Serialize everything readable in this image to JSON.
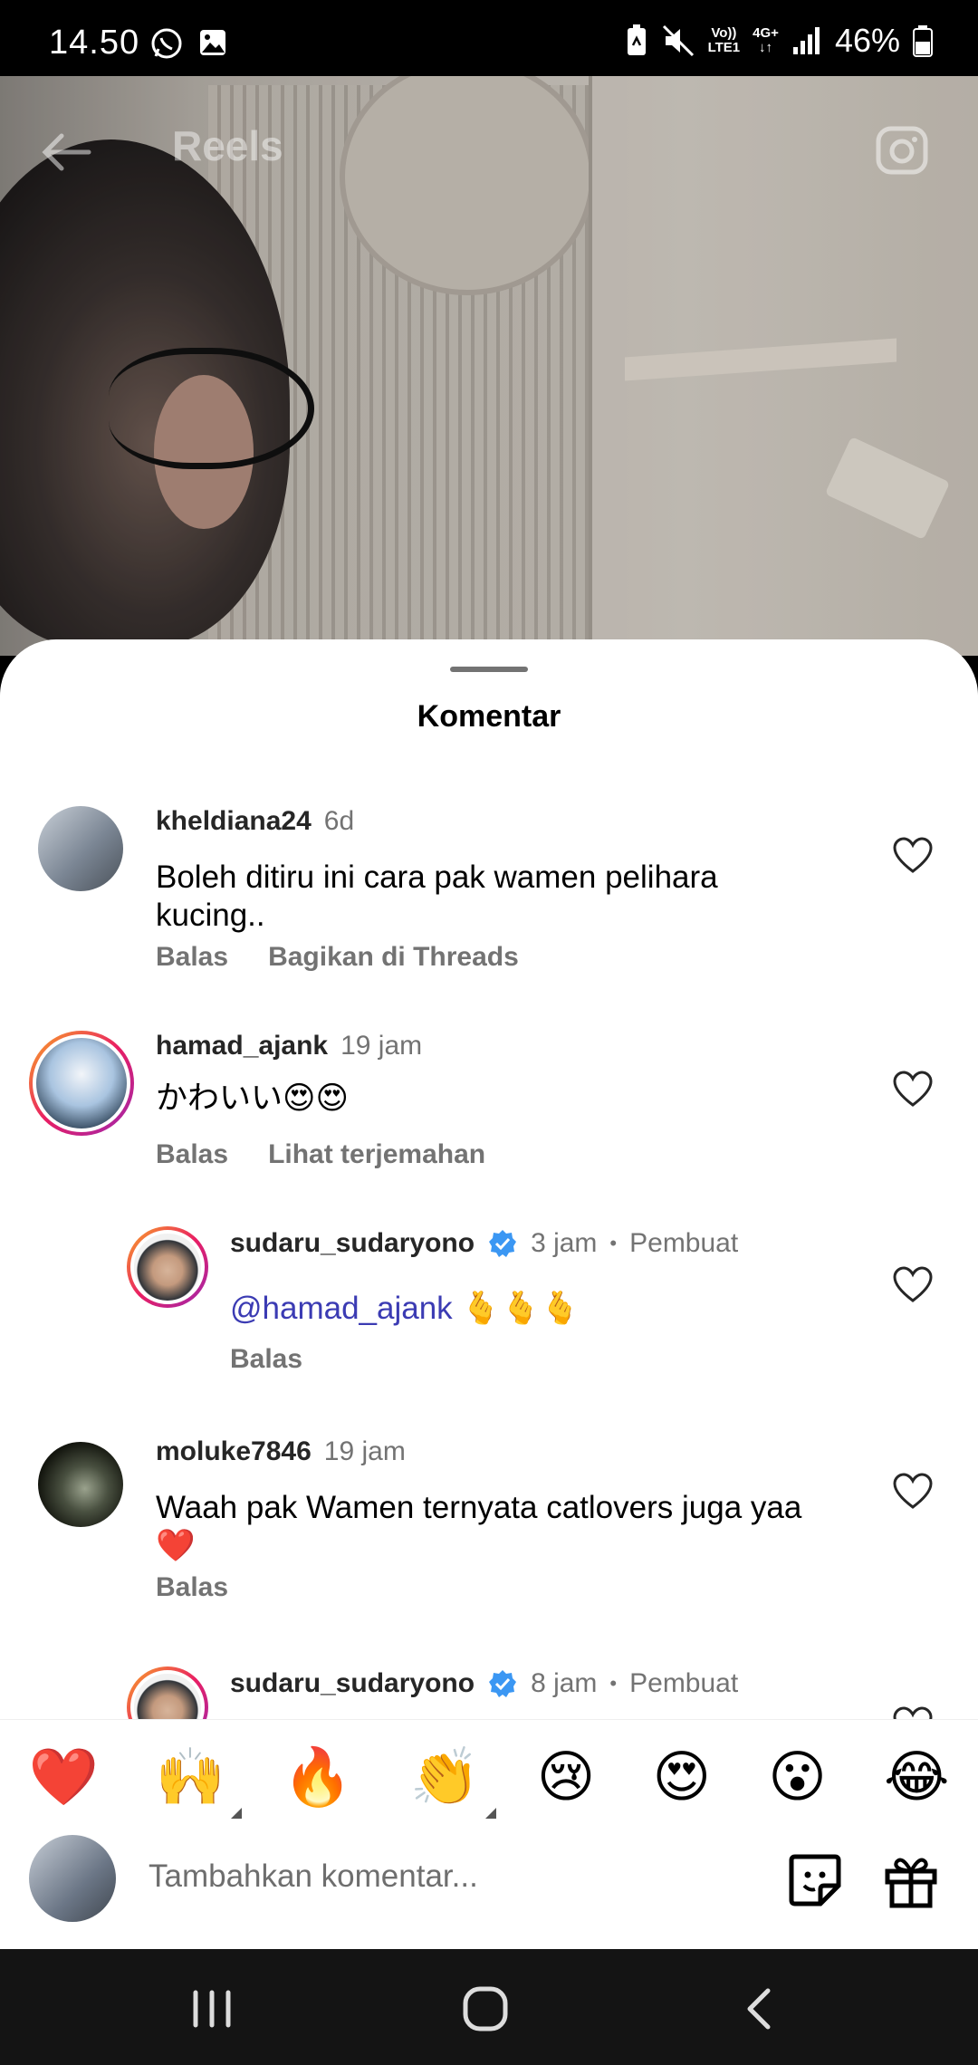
{
  "status_bar": {
    "time": "14.50",
    "network_top": "Vo))",
    "network_bottom": "LTE1",
    "net_type_top": "4G+",
    "battery": "46%"
  },
  "video": {
    "title": "Reels"
  },
  "sheet": {
    "title": "Komentar",
    "comments": [
      {
        "username": "kheldiana24",
        "time": "6d",
        "text": "Boleh ditiru ini cara pak wamen pelihara kucing..",
        "actions": [
          "Balas",
          "Bagikan di Threads"
        ]
      },
      {
        "username": "hamad_ajank",
        "time": "19 jam",
        "text": "かわいい😍😍",
        "actions": [
          "Balas",
          "Lihat terjemahan"
        ]
      },
      {
        "username": "sudaru_sudaryono",
        "time": "3 jam",
        "badge": "Pembuat",
        "mention": "@hamad_ajank",
        "text": " 🫰🫰🫰",
        "actions": [
          "Balas"
        ]
      },
      {
        "username": "moluke7846",
        "time": "19 jam",
        "text": "Waah pak Wamen ternyata catlovers juga yaa ❤️",
        "actions": [
          "Balas"
        ]
      },
      {
        "username": "sudaru_sudaryono",
        "time": "8 jam",
        "badge": "Pembuat"
      }
    ]
  },
  "emoji_bar": [
    "❤️",
    "🙌",
    "🔥",
    "👏",
    "😢",
    "😍",
    "😮",
    "😂"
  ],
  "composer": {
    "placeholder": "Tambahkan komentar..."
  }
}
